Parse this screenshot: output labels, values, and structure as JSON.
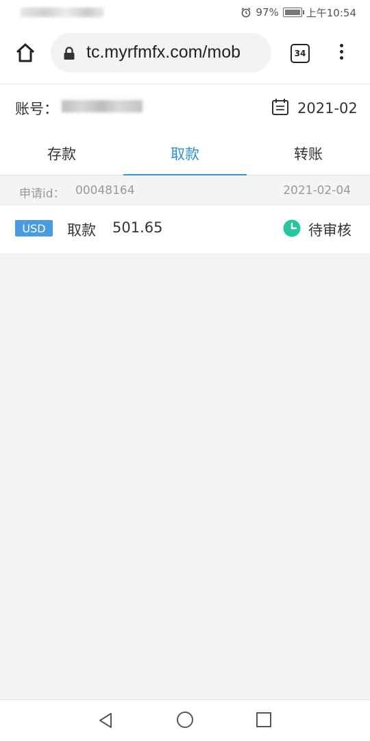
{
  "status_bar": {
    "battery_percent": "97%",
    "time": "上午10:54",
    "icons": [
      "alarm-icon",
      "battery-icon"
    ]
  },
  "browser": {
    "url": "tc.myrfmfx.com/mob",
    "tab_count": "34",
    "icons": [
      "home-icon",
      "lock-icon",
      "tabs-icon",
      "menu-icon"
    ]
  },
  "account": {
    "label": "账号：",
    "month": "2021-02",
    "icon": "calendar-icon"
  },
  "tabs": [
    {
      "label": "存款",
      "active": false
    },
    {
      "label": "取款",
      "active": true
    },
    {
      "label": "转账",
      "active": false
    }
  ],
  "record_header": {
    "id_label": "申请id：",
    "id_value": "00048164",
    "date": "2021-02-04"
  },
  "record": {
    "currency": "USD",
    "type": "取款",
    "amount": "501.65",
    "status": "待审核",
    "status_icon": "clock-icon"
  },
  "colors": {
    "accent": "#2f8fd8",
    "badge": "#4a9be0",
    "status_icon": "#26c6a0",
    "background": "#f4f4f5"
  },
  "nav": {
    "icons": [
      "back-icon",
      "home-circle-icon",
      "recents-icon"
    ]
  }
}
